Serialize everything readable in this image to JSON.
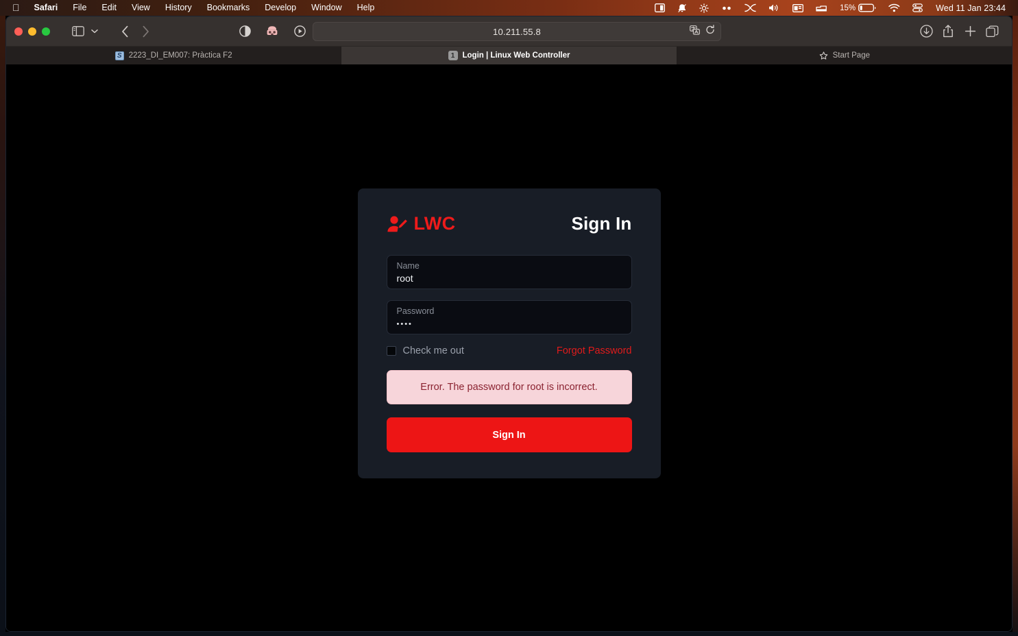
{
  "menubar": {
    "apple_label": "",
    "items": [
      {
        "label": "Safari",
        "bold": true
      },
      {
        "label": "File",
        "bold": false
      },
      {
        "label": "Edit",
        "bold": false
      },
      {
        "label": "View",
        "bold": false
      },
      {
        "label": "History",
        "bold": false
      },
      {
        "label": "Bookmarks",
        "bold": false
      },
      {
        "label": "Develop",
        "bold": false
      },
      {
        "label": "Window",
        "bold": false
      },
      {
        "label": "Help",
        "bold": false
      }
    ],
    "status_icons": [
      "screen-mirroring-icon",
      "notification-bell-icon",
      "brightness-icon",
      "dots-icon",
      "shortcuts-icon",
      "volume-icon",
      "display-icon",
      "bed-icon"
    ],
    "battery_percent": "15%",
    "wifi_icon": "wifi-icon",
    "control-center_icon": "control-center-icon",
    "clock": "Wed 11 Jan  23:44"
  },
  "toolbar": {
    "sidebar_icon": "sidebar-icon",
    "sidebar_chevron_icon": "chevron-down-icon",
    "back_icon": "back-chevron-icon",
    "forward_icon": "forward-chevron-icon",
    "reader_icon": "reader-contrast-icon",
    "extension_icon": "extension-icon",
    "media_icon": "play-circle-icon",
    "privacy_icon": "privacy-shield-icon",
    "url": "10.211.55.8",
    "translate_icon": "translate-icon",
    "reload_icon": "reload-icon",
    "downloads_icon": "download-icon",
    "share_icon": "share-icon",
    "newtab_icon": "plus-icon",
    "tabs_icon": "tab-overview-icon"
  },
  "tabs": [
    {
      "label": "2223_DI_EM007: Pràctica F2",
      "favicon": "moodle-s-icon",
      "active": false
    },
    {
      "label": "Login | Linux Web Controller",
      "favicon": "numbered-favicon-1",
      "active": true
    },
    {
      "label": "Start Page",
      "favicon": "star-icon",
      "active": false
    }
  ],
  "login": {
    "brand_icon": "user-edit-icon",
    "brand_text": "LWC",
    "title": "Sign In",
    "name_field": {
      "label": "Name",
      "value": "root",
      "placeholder": "Name"
    },
    "password_field": {
      "label": "Password",
      "value": "••••",
      "placeholder": "Password"
    },
    "checkbox_label": "Check me out",
    "checkbox_checked": false,
    "forgot_label": "Forgot Password",
    "error_message": "Error. The password for root is incorrect.",
    "submit_label": "Sign In",
    "colors": {
      "accent": "#ed1515",
      "brand": "#ee1b1b",
      "card_bg": "#181d26",
      "field_bg": "#0a0c12",
      "error_bg": "#f7d5da",
      "error_text": "#8a2230"
    }
  }
}
